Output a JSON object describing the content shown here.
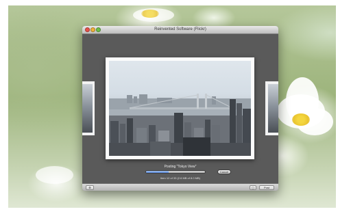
{
  "window": {
    "title": "Reinvented Software (Flickr)",
    "traffic_lights": [
      {
        "name": "close",
        "color": "#e8524a"
      },
      {
        "name": "minimize",
        "color": "#f0b23a"
      },
      {
        "name": "zoom",
        "color": "#6fbf4a"
      }
    ]
  },
  "upload": {
    "status_text": "Posting \"Tokyo View\"",
    "detail_text": "Item 12 of 33 (2.6 MB of 8.0 MB)",
    "progress_fraction": 0.38,
    "cancel_label": "Cancel"
  },
  "toolbar": {
    "left_icon": "gear-icon",
    "left_glyph": "⚙",
    "mid_glyph": "▢",
    "right_label": "Post"
  },
  "colors": {
    "progress_fill": "#4f7fd1",
    "window_bg": "#595959"
  }
}
